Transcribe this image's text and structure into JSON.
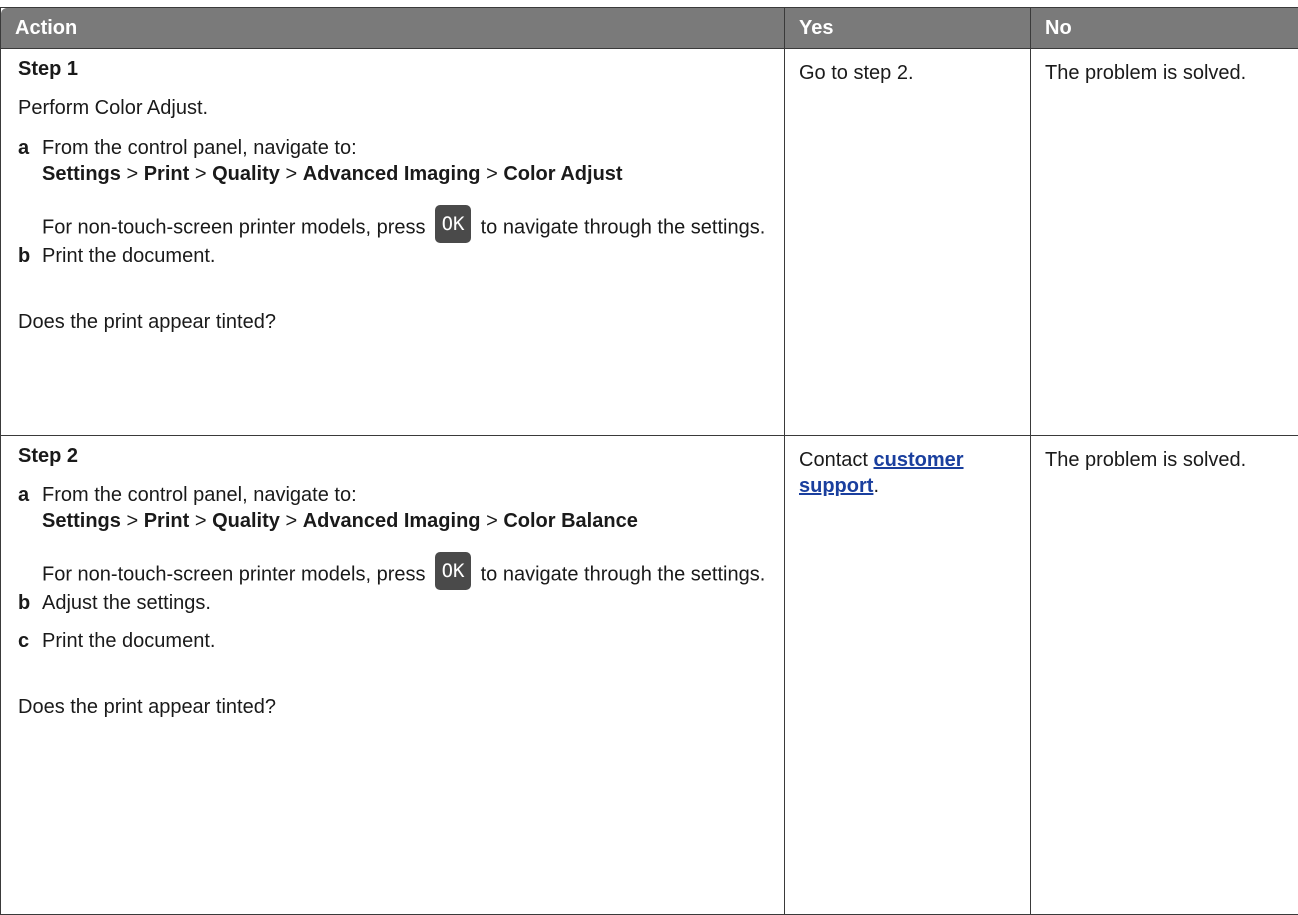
{
  "header": {
    "action": "Action",
    "yes": "Yes",
    "no": "No"
  },
  "rows": [
    {
      "step_title": "Step 1",
      "intro": "Perform Color Adjust.",
      "items": [
        {
          "marker": "a",
          "text": "From the control panel, navigate to:",
          "nav": [
            "Settings",
            "Print",
            "Quality",
            "Advanced Imaging",
            "Color Adjust"
          ],
          "sep": ">",
          "note_pre": "For non-touch-screen printer models, press",
          "key": "OK",
          "note_post": "to navigate through the settings."
        },
        {
          "marker": "b",
          "text": "Print the document."
        }
      ],
      "question": "Does the print appear tinted?",
      "yes": "Go to step 2.",
      "no": "The problem is solved."
    },
    {
      "step_title": "Step 2",
      "items": [
        {
          "marker": "a",
          "text": "From the control panel, navigate to:",
          "nav": [
            "Settings",
            "Print",
            "Quality",
            "Advanced Imaging",
            "Color Balance"
          ],
          "sep": ">",
          "note_pre": "For non-touch-screen printer models, press",
          "key": "OK",
          "note_post": "to navigate through the settings."
        },
        {
          "marker": "b",
          "text": "Adjust the settings."
        },
        {
          "marker": "c",
          "text": "Print the document."
        }
      ],
      "question": "Does the print appear tinted?",
      "yes_pre": "Contact",
      "yes_link": "customer support",
      "yes_post": ".",
      "no": "The problem is solved."
    }
  ]
}
